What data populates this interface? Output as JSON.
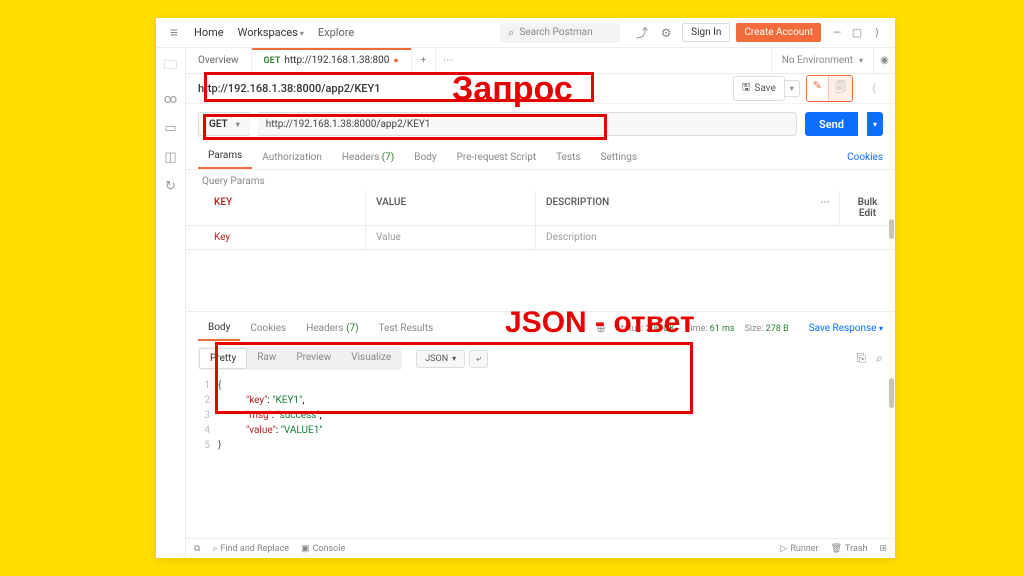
{
  "topbar": {
    "home": "Home",
    "workspaces": "Workspaces",
    "explore": "Explore",
    "search_placeholder": "Search Postman",
    "signin": "Sign In",
    "create_account": "Create Account"
  },
  "tabs": {
    "overview": "Overview",
    "active_method": "GET",
    "active_title": "http://192.168.1.38:800",
    "env": "No Environment"
  },
  "request": {
    "title": "http://192.168.1.38:8000/app2/KEY1",
    "save": "Save",
    "method": "GET",
    "url": "http://192.168.1.38:8000/app2/KEY1",
    "send": "Send"
  },
  "req_tabs": {
    "params": "Params",
    "auth": "Authorization",
    "headers": "Headers",
    "headers_count": "(7)",
    "body": "Body",
    "prereq": "Pre-request Script",
    "tests": "Tests",
    "settings": "Settings",
    "cookies": "Cookies",
    "query_params": "Query Params"
  },
  "params_table": {
    "key_hdr": "KEY",
    "val_hdr": "VALUE",
    "desc_hdr": "DESCRIPTION",
    "bulk": "Bulk Edit",
    "key_ph": "Key",
    "val_ph": "Value",
    "desc_ph": "Description"
  },
  "resp_tabs": {
    "body": "Body",
    "cookies": "Cookies",
    "headers": "Headers",
    "headers_count": "(7)",
    "tests": "Test Results"
  },
  "resp_status": {
    "status_label": "Status:",
    "status_value": "200 OK",
    "time_label": "Time:",
    "time_value": "61 ms",
    "size_label": "Size:",
    "size_value": "278 B",
    "save_resp": "Save Response"
  },
  "resp_views": {
    "pretty": "Pretty",
    "raw": "Raw",
    "preview": "Preview",
    "visualize": "Visualize",
    "format": "JSON"
  },
  "response_json": {
    "l1": "{",
    "l2a": "\"key\"",
    "l2b": ": ",
    "l2c": "\"KEY1\"",
    "l2d": ",",
    "l3a": "\"msg\"",
    "l3b": ": ",
    "l3c": "\"success\"",
    "l3d": ",",
    "l4a": "\"value\"",
    "l4b": ": ",
    "l4c": "\"VALUE1\"",
    "l5": "}",
    "ln1": "1",
    "ln2": "2",
    "ln3": "3",
    "ln4": "4",
    "ln5": "5"
  },
  "footer": {
    "find": "Find and Replace",
    "console": "Console",
    "runner": "Runner",
    "trash": "Trash"
  },
  "annotations": {
    "request": "Запрос",
    "json": "JSON - ответ"
  }
}
